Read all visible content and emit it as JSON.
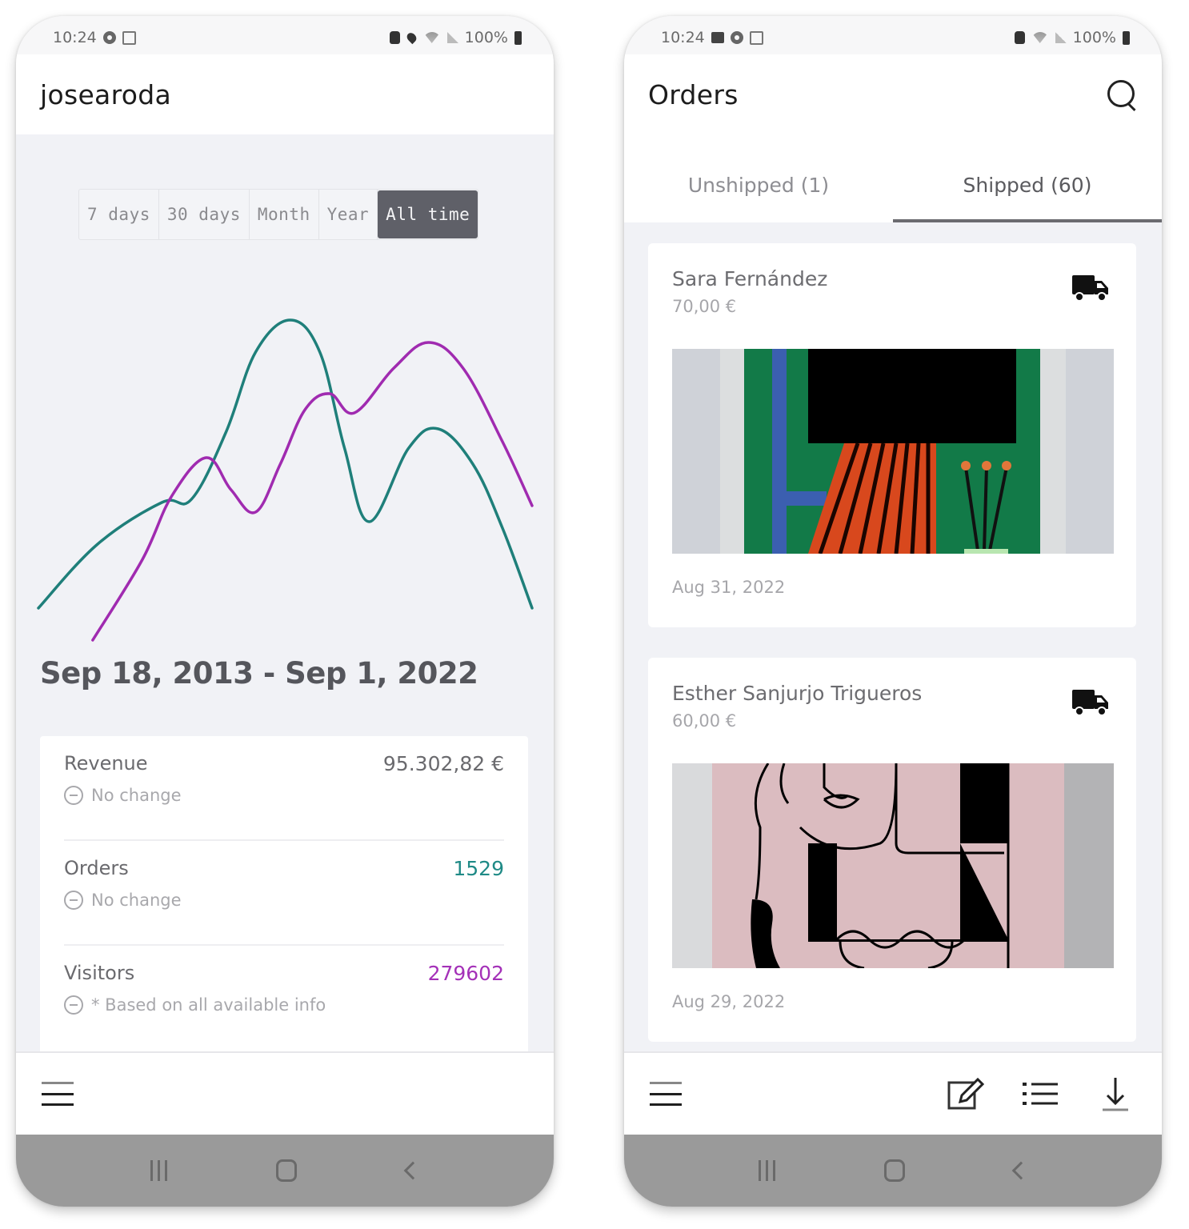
{
  "left_screen": {
    "status_bar": {
      "time": "10:24",
      "battery": "100%"
    },
    "header": {
      "title": "josearoda"
    },
    "range_selector": {
      "options": [
        "7 days",
        "30 days",
        "Month",
        "Year",
        "All time"
      ],
      "selected": "All time"
    },
    "date_range": "Sep 18, 2013 - Sep 1, 2022",
    "stats": [
      {
        "label": "Revenue",
        "value": "95.302,82 €",
        "sub": "No change",
        "color": "#6a6a6e"
      },
      {
        "label": "Orders",
        "value": "1529",
        "sub": "No change",
        "color": "#1f8a86"
      },
      {
        "label": "Visitors",
        "value": "279602",
        "sub": "* Based on all available info",
        "color": "#a431b8"
      }
    ],
    "bottom_bar": {
      "menu_icon": "hamburger-menu-icon"
    }
  },
  "right_screen": {
    "status_bar": {
      "time": "10:24",
      "battery": "100%"
    },
    "header": {
      "title": "Orders",
      "action_icon": "search-icon"
    },
    "tabs": [
      {
        "label": "Unshipped (1)",
        "active": false
      },
      {
        "label": "Shipped (60)",
        "active": true
      }
    ],
    "orders": [
      {
        "customer": "Sara Fernández",
        "amount": "70,00 €",
        "date": "Aug 31, 2022",
        "status_icon": "truck-icon"
      },
      {
        "customer": "Esther Sanjurjo Trigueros",
        "amount": "60,00 €",
        "date": "Aug 29, 2022",
        "status_icon": "truck-icon"
      }
    ],
    "bottom_bar": {
      "icons": [
        "hamburger-menu-icon",
        "edit-icon",
        "list-icon",
        "download-icon"
      ]
    }
  },
  "system_nav": [
    "recent-apps-icon",
    "home-icon",
    "back-icon"
  ],
  "chart_data": {
    "type": "line",
    "title": "",
    "xlabel": "",
    "ylabel": "",
    "grid": false,
    "legend": "none",
    "ylim": [
      0,
      100
    ],
    "xlim": [
      0,
      100
    ],
    "series": [
      {
        "name": "Orders",
        "color": "#1f7f7a",
        "points": [
          [
            0,
            10
          ],
          [
            12,
            30
          ],
          [
            25,
            43
          ],
          [
            31,
            44
          ],
          [
            38,
            65
          ],
          [
            44,
            90
          ],
          [
            51,
            100
          ],
          [
            57,
            90
          ],
          [
            62,
            60
          ],
          [
            67,
            37
          ],
          [
            75,
            60
          ],
          [
            81,
            66
          ],
          [
            88,
            55
          ],
          [
            94,
            35
          ],
          [
            100,
            10
          ]
        ]
      },
      {
        "name": "Visitors",
        "color": "#a02bb0",
        "points": [
          [
            11,
            0
          ],
          [
            21,
            25
          ],
          [
            27,
            45
          ],
          [
            34,
            57
          ],
          [
            39,
            47
          ],
          [
            44,
            40
          ],
          [
            49,
            55
          ],
          [
            54,
            72
          ],
          [
            59,
            77
          ],
          [
            64,
            71
          ],
          [
            72,
            85
          ],
          [
            79,
            93
          ],
          [
            86,
            85
          ],
          [
            94,
            62
          ],
          [
            100,
            42
          ]
        ]
      }
    ]
  }
}
